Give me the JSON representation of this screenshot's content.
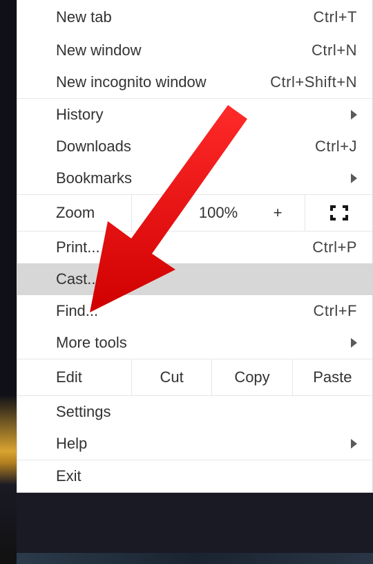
{
  "menu": {
    "new_tab": {
      "label": "New tab",
      "shortcut": "Ctrl+T"
    },
    "new_window": {
      "label": "New window",
      "shortcut": "Ctrl+N"
    },
    "new_incognito": {
      "label": "New incognito window",
      "shortcut": "Ctrl+Shift+N"
    },
    "history": {
      "label": "History"
    },
    "downloads": {
      "label": "Downloads",
      "shortcut": "Ctrl+J"
    },
    "bookmarks": {
      "label": "Bookmarks"
    },
    "zoom": {
      "label": "Zoom",
      "minus": "−",
      "value": "100%",
      "plus": "+"
    },
    "print": {
      "label": "Print...",
      "shortcut": "Ctrl+P"
    },
    "cast": {
      "label": "Cast..."
    },
    "find": {
      "label": "Find...",
      "shortcut": "Ctrl+F"
    },
    "more_tools": {
      "label": "More tools"
    },
    "edit": {
      "label": "Edit",
      "cut": "Cut",
      "copy": "Copy",
      "paste": "Paste"
    },
    "settings": {
      "label": "Settings"
    },
    "help": {
      "label": "Help"
    },
    "exit": {
      "label": "Exit"
    }
  },
  "annotation": {
    "arrow_color": "#e81c1c",
    "arrow_target": "cast"
  }
}
